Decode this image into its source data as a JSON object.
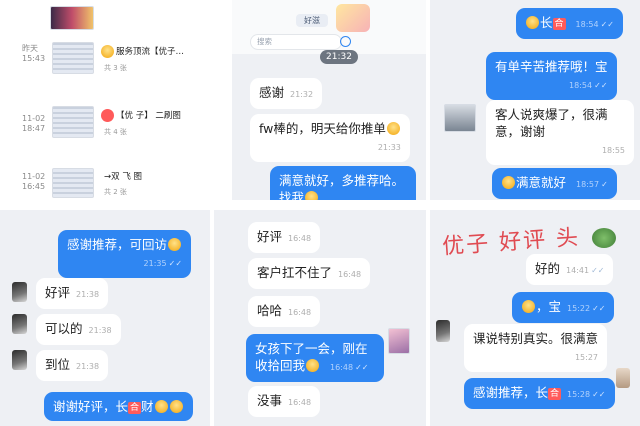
{
  "panel1": {
    "items": [
      {
        "time": "昨天\n15:43",
        "title": "服务顶流【优子…",
        "sub": "共 3 张"
      },
      {
        "time": "11-02\n18:47",
        "title": "【优 子】  二刷图",
        "sub": "共 4 张"
      },
      {
        "time": "11-02\n16:45",
        "title": "→双 飞 图",
        "sub": "共 2 张"
      }
    ]
  },
  "panel2": {
    "search_placeholder": "搜索",
    "chip": "好滋",
    "time_chip": "21:32",
    "messages": [
      {
        "text": "感谢",
        "time": "21:32"
      },
      {
        "text": "fw棒的，明天给你推单",
        "time": "21:33"
      },
      {
        "text": "满意就好，多推荐哈。找我",
        "time": ""
      }
    ]
  },
  "panel3": {
    "messages": [
      {
        "text": "长",
        "time": "18:54"
      },
      {
        "text": "有单辛苦推荐哦！宝",
        "time": "18:54"
      },
      {
        "text": "客人说爽爆了，很满意，谢谢",
        "time": "18:55"
      },
      {
        "text": "满意就好",
        "time": "18:57"
      }
    ]
  },
  "panel4": {
    "messages": [
      {
        "text": "感谢推荐，可回访",
        "time": "21:35"
      },
      {
        "text": "好评",
        "time": "21:38"
      },
      {
        "text": "可以的",
        "time": "21:38"
      },
      {
        "text": "到位",
        "time": "21:38"
      },
      {
        "text": "谢谢好评，长",
        "time": ""
      }
    ],
    "cai": "合",
    "cai2": "财"
  },
  "panel5": {
    "messages": [
      {
        "text": "好评",
        "time": "16:48"
      },
      {
        "text": "客户扛不住了",
        "time": "16:48"
      },
      {
        "text": "哈哈",
        "time": "16:48"
      },
      {
        "text": "女孩下了一会，刚在收拾回我",
        "time": "16:48"
      },
      {
        "text": "没事",
        "time": "16:48"
      }
    ]
  },
  "panel6": {
    "handwriting": "优子 好评 头",
    "messages": [
      {
        "text": "好的",
        "time": "14:41"
      },
      {
        "text": "，宝",
        "time": "15:22"
      },
      {
        "text": "课说特别真实。很满意",
        "time": "15:27"
      },
      {
        "text": "感谢推荐，长",
        "time": "15:28"
      }
    ]
  },
  "colors": {
    "accent": "#2f86f2"
  },
  "icons": [
    "avatar-icon",
    "read-check-icon",
    "emoji-icon"
  ]
}
